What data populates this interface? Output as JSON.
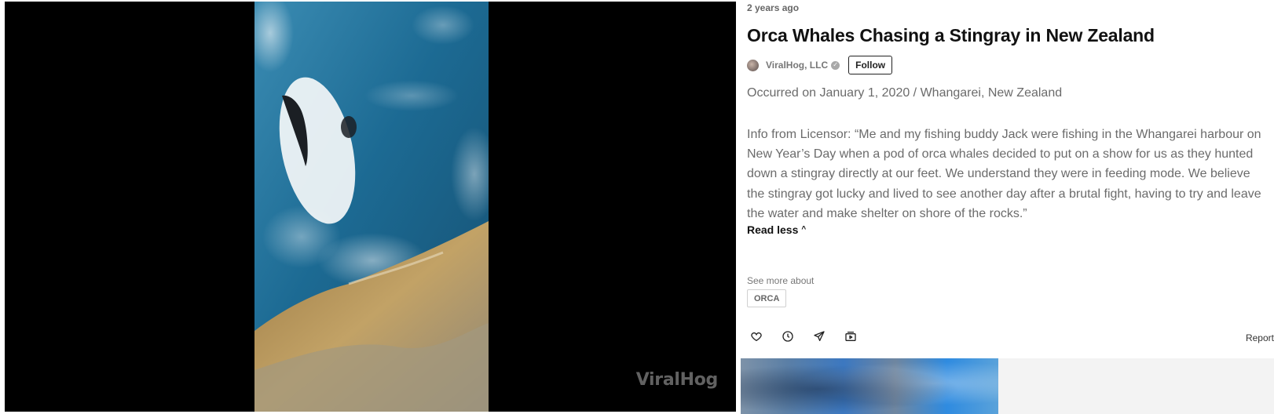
{
  "player": {
    "watermark": "ViralHog"
  },
  "video": {
    "timestamp": "2 years ago",
    "title": "Orca Whales Chasing a Stingray in New Zealand",
    "channel": {
      "name": "ViralHog, LLC",
      "verified": true,
      "follow_label": "Follow"
    },
    "occurred": "Occurred on January 1, 2020 / Whangarei, New Zealand",
    "description": "Info from Licensor: “Me and my fishing buddy Jack were fishing in the Whangarei harbour on New Year’s Day when a pod of orca whales decided to put on a show for us as they hunted down a stingray directly at our feet. We understand they were in feeding mode. We believe the stingray got lucky and lived to see another day after a brutal fight, having to try and leave the water and make shelter on shore of the rocks.”",
    "read_less_label": "Read less",
    "see_more_label": "See more about",
    "tags": [
      "ORCA"
    ]
  },
  "actions": {
    "icons": [
      "heart-icon",
      "clock-icon",
      "send-icon",
      "playlist-icon"
    ],
    "report_label": "Report"
  },
  "colors": {
    "player_bg": "#000000",
    "text_primary": "#111111",
    "text_secondary": "#6b6b6b",
    "water": "#1d5f86",
    "rocks": "#b89a5e"
  }
}
